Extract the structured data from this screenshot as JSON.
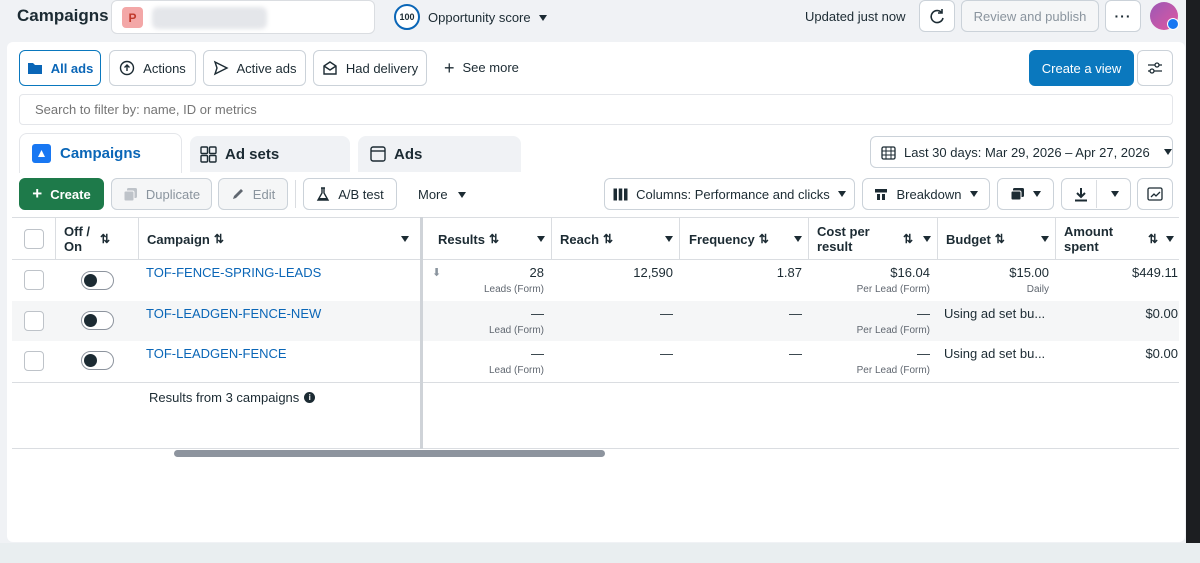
{
  "header": {
    "title": "Campaigns",
    "account_initial": "P",
    "score_value": "100",
    "score_label": "Opportunity score",
    "updated": "Updated just now",
    "review_publish": "Review and publish"
  },
  "filters": {
    "all_ads": "All ads",
    "actions": "Actions",
    "active_ads": "Active ads",
    "had_delivery": "Had delivery",
    "see_more": "See more",
    "create_view": "Create a view"
  },
  "search": {
    "placeholder": "Search to filter by: name, ID or metrics"
  },
  "tabs": {
    "campaigns": "Campaigns",
    "ad_sets": "Ad sets",
    "ads": "Ads"
  },
  "date_range": "Last 30 days: Mar 29, 2026 – Apr 27, 2026",
  "toolbar": {
    "create": "Create",
    "duplicate": "Duplicate",
    "edit": "Edit",
    "ab_test": "A/B test",
    "more": "More",
    "columns": "Columns: Performance and clicks",
    "breakdown": "Breakdown"
  },
  "table": {
    "headers": {
      "off_on_1": "Off /",
      "off_on_2": "On",
      "campaign": "Campaign",
      "results": "Results",
      "reach": "Reach",
      "frequency": "Frequency",
      "cost_1": "Cost per",
      "cost_2": "result",
      "budget": "Budget",
      "amount_1": "Amount",
      "amount_2": "spent"
    },
    "rows": [
      {
        "name": "TOF-FENCE-SPRING-LEADS",
        "results": "28",
        "results_sub": "Leads (Form)",
        "reach": "12,590",
        "frequency": "1.87",
        "cost": "$16.04",
        "cost_sub": "Per Lead (Form)",
        "budget": "$15.00",
        "budget_sub": "Daily",
        "spent": "$449.11"
      },
      {
        "name": "TOF-LEADGEN-FENCE-NEW",
        "results": "—",
        "results_sub": "Lead (Form)",
        "reach": "—",
        "frequency": "—",
        "cost": "—",
        "cost_sub": "Per Lead (Form)",
        "budget": "Using ad set bu...",
        "budget_sub": "",
        "spent": "$0.00"
      },
      {
        "name": "TOF-LEADGEN-FENCE",
        "results": "—",
        "results_sub": "Lead (Form)",
        "reach": "—",
        "frequency": "—",
        "cost": "—",
        "cost_sub": "Per Lead (Form)",
        "budget": "Using ad set bu...",
        "budget_sub": "",
        "spent": "$0.00"
      }
    ],
    "footer": "Results from 3 campaigns"
  },
  "colors": {
    "accent": "#0a78be",
    "create_green": "#1e7a4a",
    "link": "#0a66b7"
  }
}
